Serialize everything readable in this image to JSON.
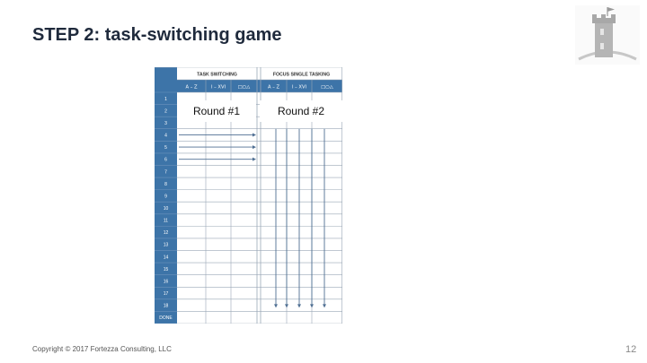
{
  "slide": {
    "title": "STEP 2: task-switching game",
    "footer": "Copyright  © 2017 Fortezza Consulting, LLC",
    "page_number": "12"
  },
  "worksheet": {
    "group_headers": [
      "TASK SWITCHING",
      "FOCUS SINGLE TASKING"
    ],
    "column_headers": [
      "A – Z",
      "I – XVI",
      "□○△",
      "A – Z",
      "I – XVI",
      "□○△"
    ],
    "row_labels": [
      "1",
      "2",
      "3",
      "4",
      "5",
      "6",
      "7",
      "8",
      "9",
      "10",
      "11",
      "12",
      "13",
      "14",
      "15",
      "16",
      "17",
      "18",
      "DONE"
    ],
    "round_labels": [
      "Round #1",
      "Round #2"
    ],
    "header_color": "#3d74a8",
    "line_color": "#9aa7b6",
    "arrow_color": "#4f6f93"
  },
  "logo": {
    "icon": "castle-tower-icon",
    "color": "#b0b0b0"
  }
}
